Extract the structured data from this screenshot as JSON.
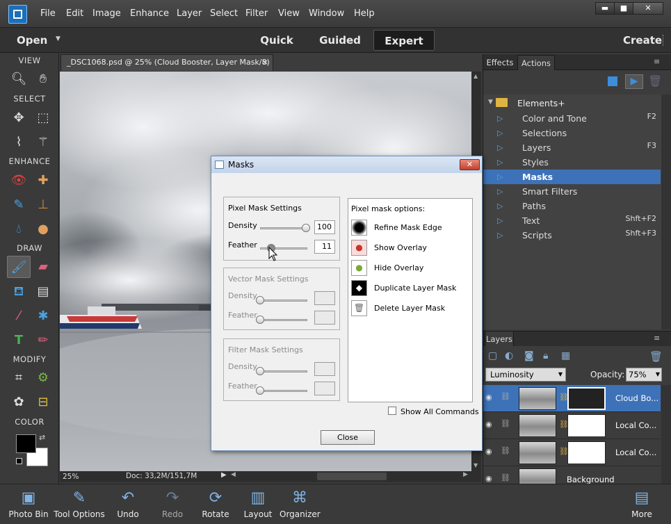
{
  "menu": [
    "File",
    "Edit",
    "Image",
    "Enhance",
    "Layer",
    "Select",
    "Filter",
    "View",
    "Window",
    "Help"
  ],
  "window_controls": {
    "min": "▬",
    "max": "■",
    "close": "✕"
  },
  "modebar": {
    "open": "Open",
    "quick": "Quick",
    "guided": "Guided",
    "expert": "Expert",
    "create": "Create"
  },
  "toolbox": {
    "view": "VIEW",
    "select": "SELECT",
    "enhance": "ENHANCE",
    "draw": "DRAW",
    "modify": "MODIFY",
    "color": "COLOR"
  },
  "doc_tab": {
    "title": "_DSC1068.psd @ 25% (Cloud Booster, Layer Mask/8) *",
    "close": "×"
  },
  "status": {
    "zoom": "25%",
    "doc": "Doc: 33,2M/151,7M"
  },
  "panels": {
    "tab_effects": "Effects",
    "tab_actions": "Actions",
    "tab_layers": "Layers"
  },
  "actions": {
    "folder": "Elements+",
    "items": [
      {
        "label": "Color and Tone",
        "key": "F2"
      },
      {
        "label": "Selections",
        "key": ""
      },
      {
        "label": "Layers",
        "key": "F3"
      },
      {
        "label": "Styles",
        "key": ""
      },
      {
        "label": "Masks",
        "key": ""
      },
      {
        "label": "Smart Filters",
        "key": ""
      },
      {
        "label": "Paths",
        "key": ""
      },
      {
        "label": "Text",
        "key": "Shft+F2"
      },
      {
        "label": "Scripts",
        "key": "Shft+F3"
      }
    ],
    "selected_index": 4
  },
  "layers": {
    "blend_mode": "Luminosity",
    "opacity_label": "Opacity:",
    "opacity_value": "75%",
    "rows": [
      {
        "name": "Cloud Bo..."
      },
      {
        "name": "Local Co..."
      },
      {
        "name": "Local Co..."
      },
      {
        "name": "Background"
      }
    ]
  },
  "dialog": {
    "title": "Masks",
    "pixel_group": "Pixel Mask Settings",
    "vector_group": "Vector Mask Settings",
    "filter_group": "Filter Mask Settings",
    "density": "Density",
    "feather": "Feather",
    "pixel_density_value": "100",
    "pixel_feather_value": "11",
    "pixel_density_level": 1.0,
    "pixel_feather_level": 0.2,
    "options_title": "Pixel mask options:",
    "options": [
      "Refine Mask Edge",
      "Show Overlay",
      "Hide Overlay",
      "Duplicate Layer Mask",
      "Delete Layer Mask"
    ],
    "show_all": "Show All Commands",
    "close_button": "Close"
  },
  "bottom": [
    "Photo Bin",
    "Tool Options",
    "Undo",
    "Redo",
    "Rotate",
    "Layout",
    "Organizer",
    "More"
  ]
}
